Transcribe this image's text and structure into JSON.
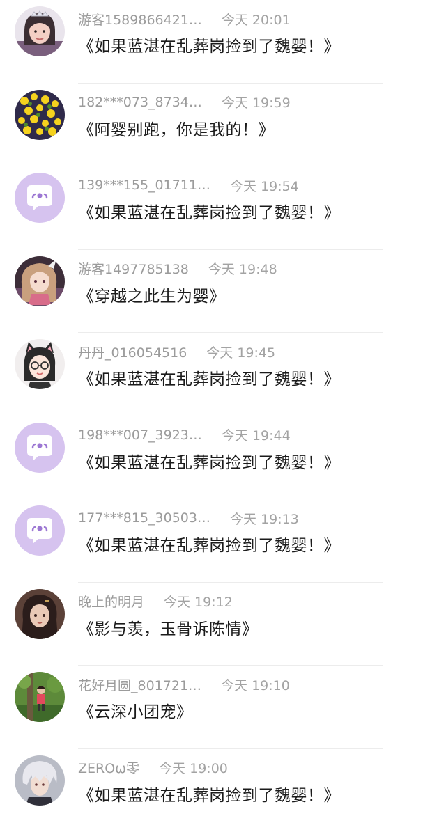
{
  "colors": {
    "default_avatar_bg": "#d6c3ef",
    "default_avatar_fg": "#9c77d3",
    "meta_text": "#9b9b9b",
    "title_text": "#1b1b1b"
  },
  "items": [
    {
      "username": "游客1589866421…",
      "time": "今天 20:01",
      "title": "《如果蓝湛在乱葬岗捡到了魏婴！》",
      "avatar": "photo-woman-icon"
    },
    {
      "username": "182***073_8734…",
      "time": "今天 19:59",
      "title": "《阿婴别跑，你是我的！》",
      "avatar": "photo-flowers-icon"
    },
    {
      "username": "139***155_01711…",
      "time": "今天 19:54",
      "title": "《如果蓝湛在乱葬岗捡到了魏婴！》",
      "avatar": "default-chat-icon"
    },
    {
      "username": "游客1497785138",
      "time": "今天 19:48",
      "title": "《穿越之此生为婴》",
      "avatar": "anime-girl-icon"
    },
    {
      "username": "丹丹_016054516",
      "time": "今天 19:45",
      "title": "《如果蓝湛在乱葬岗捡到了魏婴！》",
      "avatar": "cartoon-cat-girl-icon"
    },
    {
      "username": "198***007_3923…",
      "time": "今天 19:44",
      "title": "《如果蓝湛在乱葬岗捡到了魏婴！》",
      "avatar": "default-chat-icon"
    },
    {
      "username": "177***815_30503…",
      "time": "今天 19:13",
      "title": "《如果蓝湛在乱葬岗捡到了魏婴！》",
      "avatar": "default-chat-icon"
    },
    {
      "username": "晚上的明月",
      "time": "今天 19:12",
      "title": "《影与羡，玉骨诉陈情》",
      "avatar": "anime-lady-icon"
    },
    {
      "username": "花好月圆_801721…",
      "time": "今天 19:10",
      "title": "《云深小团宠》",
      "avatar": "photo-child-icon"
    },
    {
      "username": "ZEROω零",
      "time": "今天 19:00",
      "title": "《如果蓝湛在乱葬岗捡到了魏婴！》",
      "avatar": "anime-boy-icon"
    }
  ]
}
